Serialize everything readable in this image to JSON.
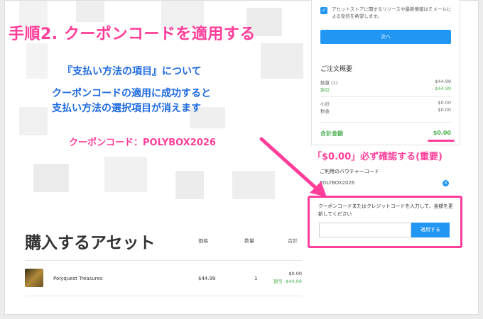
{
  "checkbox_text": "アセットストアに関するリソースや最新情報はＥメールによる受信を希望します。",
  "next_button": "次へ",
  "order_summary": {
    "title": "ご注文概要",
    "quantity_label": "数量 (1)",
    "quantity_value": "$44.99",
    "discount_label": "割引",
    "discount_value": "- $44.99",
    "subtotal_label": "小計",
    "subtotal_value": "$0.00",
    "tax_label": "税金",
    "tax_value": "$0.00",
    "total_label": "合計金額",
    "total_value": "$0.00"
  },
  "voucher": {
    "title": "ご利用のバウチャーコード",
    "code": "POLYBOX2026",
    "remove_icon": "×"
  },
  "coupon": {
    "instruction": "クーポンコードまたはクレジットコードを入力して、金額を更新してください",
    "input_value": "",
    "apply_button": "適用する"
  },
  "annotations": {
    "step_title": "手順2. クーポンコードを適用する",
    "line1": "『支払い方法の項目』について",
    "line2": "クーポンコードの適用に成功すると",
    "line3": "支払い方法の選択項目が消えます",
    "coupon_label": "クーポンコード：POLYBOX2026",
    "confirm_note": "「$0.00」必ず確認する(重要)"
  },
  "assets": {
    "title": "購入するアセット",
    "col_price": "価格",
    "col_qty": "数量",
    "col_total": "合計",
    "item": {
      "name": "Polyquest Treasures",
      "price": "$44.99",
      "qty": "1",
      "subtotal": "$0.00",
      "discount": "割引 -$44.99"
    }
  },
  "colors": {
    "accent_blue": "#2196f3",
    "highlight_pink": "#ff3e9a",
    "discount_green": "#4caf50",
    "annotation_blue": "#1e6ae0"
  }
}
